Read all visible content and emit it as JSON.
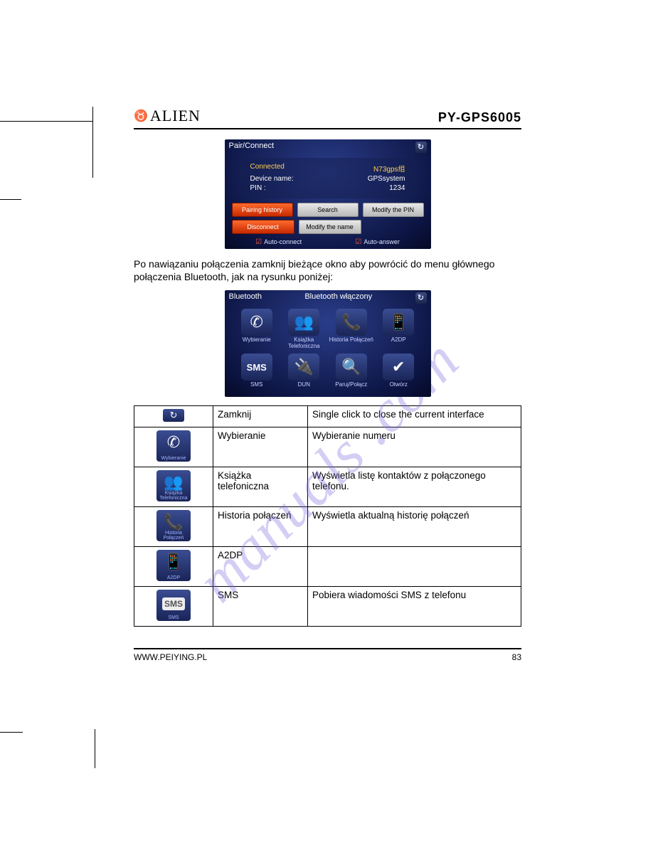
{
  "header": {
    "brand": "ALIEN",
    "model": "PY-GPS6005"
  },
  "watermark": "manuals   .com",
  "pair_screen": {
    "title": "Pair/Connect",
    "status_label": "Connected",
    "status_value": "N73gps组",
    "device_label": "Device name:",
    "device_value": "GPSsystem",
    "pin_label": "PIN    :",
    "pin_value": "1234",
    "btns_row1": [
      "Pairing history",
      "Search",
      "Modify the PIN"
    ],
    "btns_row2": [
      "Disconnect",
      "Modify the name"
    ],
    "auto_connect": "Auto-connect",
    "auto_answer": "Auto-answer"
  },
  "paragraph": "Po nawiązaniu połączenia zamknij bieżące okno aby powrócić do menu głównego połączenia Bluetooth, jak na rysunku poniżej:",
  "bt_screen": {
    "title": "Bluetooth",
    "status": "Bluetooth włączony",
    "items": [
      {
        "glyph": "✆",
        "label": "Wybieranie"
      },
      {
        "glyph": "👥",
        "label": "Książka Telefoniczna"
      },
      {
        "glyph": "📞",
        "label": "Historia Połączeń"
      },
      {
        "glyph": "📱",
        "label": "A2DP"
      },
      {
        "glyph": "SMS",
        "label": "SMS"
      },
      {
        "glyph": "🔌",
        "label": "DUN"
      },
      {
        "glyph": "🔍",
        "label": "Paruj/Połącz"
      },
      {
        "glyph": "✔",
        "label": "Otwórz"
      }
    ]
  },
  "table": [
    {
      "icon": "↻",
      "icon_small": true,
      "ilabel": "",
      "name": "Zamknij",
      "desc": "Single click to close the current interface"
    },
    {
      "icon": "✆",
      "ilabel": "Wybieranie",
      "name": "Wybieranie",
      "desc": "Wybieranie numeru"
    },
    {
      "icon": "👥",
      "ilabel": "Książka Telefoniczna",
      "name": "Książka telefoniczna",
      "desc": "Wyświetla listę kontaktów z połączonego telefonu."
    },
    {
      "icon": "📞",
      "ilabel": "Historia Połączeń",
      "name": "Historia połączeń",
      "desc": "Wyświetla aktualną historię połączeń"
    },
    {
      "icon": "📱",
      "ilabel": "A2DP",
      "name": "A2DP",
      "desc": ""
    },
    {
      "icon": "SMS",
      "ilabel": "SMS",
      "name": "SMS",
      "desc": "Pobiera wiadomości SMS z telefonu"
    }
  ],
  "footer": {
    "url": "WWW.PEIYING.PL",
    "page": "83"
  }
}
